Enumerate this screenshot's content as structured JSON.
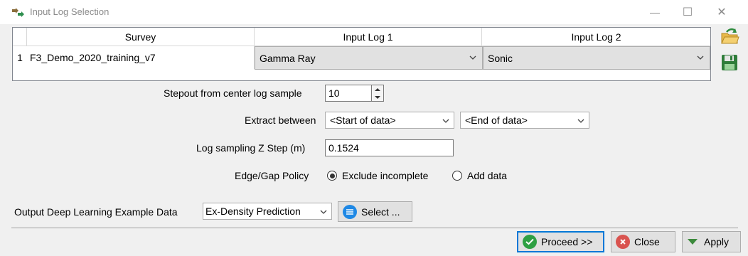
{
  "window": {
    "title": "Input Log Selection",
    "minimize_glyph": "—",
    "maximize_glyph": "☐",
    "close_glyph": "✕"
  },
  "table": {
    "headers": [
      "Survey",
      "Input Log 1",
      "Input Log 2"
    ],
    "rows": [
      {
        "num": "1",
        "survey": "F3_Demo_2020_training_v7",
        "log1": "Gamma Ray",
        "log2": "Sonic"
      }
    ]
  },
  "stepout": {
    "label": "Stepout from center log sample",
    "value": "10"
  },
  "extract": {
    "label": "Extract between",
    "start": "<Start of data>",
    "end": "<End of data>"
  },
  "zstep": {
    "label": "Log sampling Z Step (m)",
    "value": "0.1524"
  },
  "edge": {
    "label": "Edge/Gap Policy",
    "option1": "Exclude incomplete",
    "option2": "Add data",
    "selected": "Exclude incomplete"
  },
  "output": {
    "label": "Output Deep Learning Example Data",
    "value": "Ex-Density Prediction",
    "select_label": "Select ..."
  },
  "buttons": {
    "proceed": "Proceed >>",
    "close": "Close",
    "apply": "Apply"
  },
  "icons": [
    "app-icon",
    "open-folder-icon",
    "save-icon",
    "chevron-down-icon",
    "spin-up-icon",
    "spin-down-icon",
    "select-list-icon",
    "checkmark-icon",
    "close-x-icon",
    "triangle-down-icon"
  ],
  "colors": {
    "accent": "#0078d7",
    "proceed_icon": "#2ea043",
    "close_icon": "#d9534f",
    "apply_icon": "#3c8a3c",
    "select_icon": "#1e88e5"
  }
}
